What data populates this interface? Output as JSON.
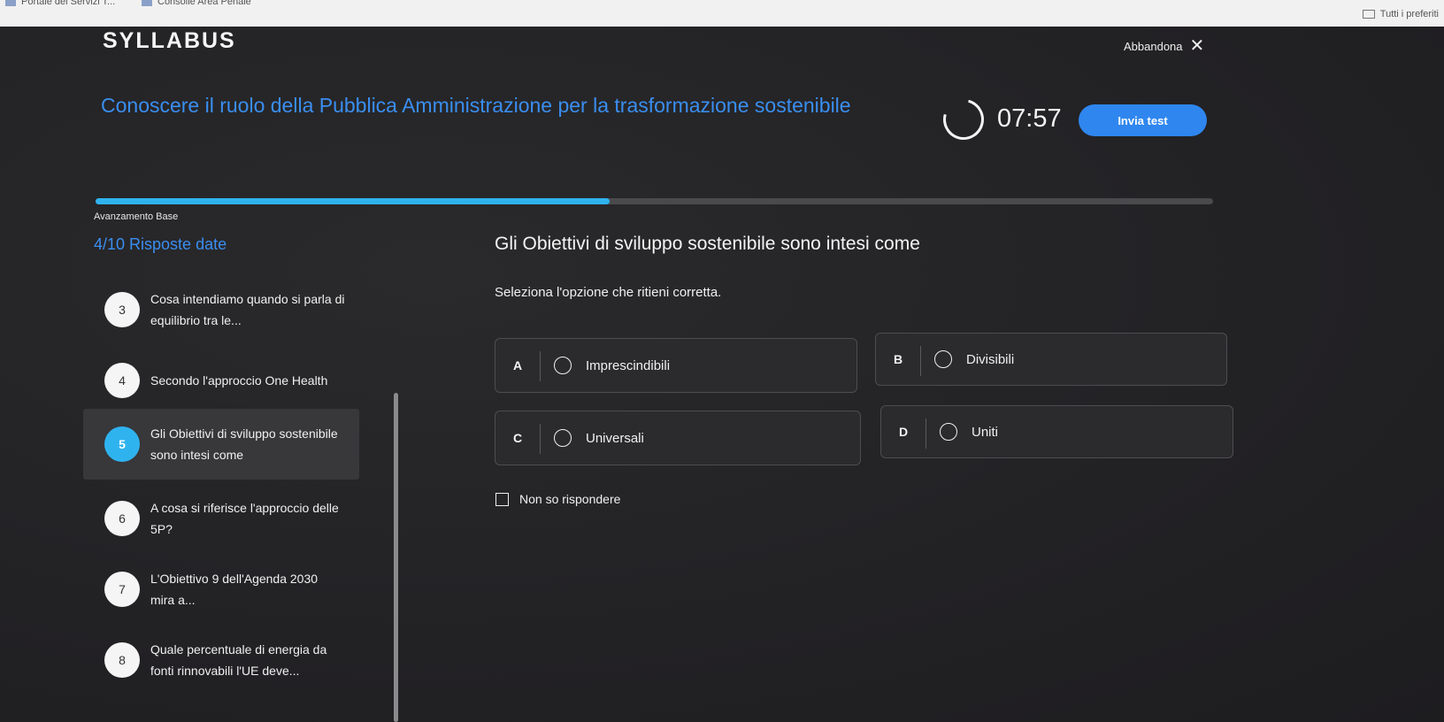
{
  "browser": {
    "bookmarks": [
      "Portale dei Servizi T...",
      "Consolle Area Penale"
    ],
    "all_bookmarks": "Tutti i preferiti"
  },
  "header": {
    "logo": "SYLLABUS",
    "leave_label": "Abbandona"
  },
  "course": {
    "title": "Conoscere il ruolo della Pubblica Amministrazione per la trasformazione sostenibile",
    "timer": "07:57",
    "submit_label": "Invia test"
  },
  "progress": {
    "label": "Avanzamento Base",
    "fraction": 0.46,
    "answered": "4/10 Risposte date"
  },
  "sidebar": {
    "questions": [
      {
        "number": "3",
        "text": "Cosa intendiamo quando si parla di equilibrio tra le..."
      },
      {
        "number": "4",
        "text": "Secondo l'approccio One Health"
      },
      {
        "number": "5",
        "text": "Gli Obiettivi di sviluppo sostenibile sono intesi come"
      },
      {
        "number": "6",
        "text": "A cosa si riferisce l'approccio delle 5P?"
      },
      {
        "number": "7",
        "text": "L'Obiettivo 9 dell'Agenda 2030 mira a..."
      },
      {
        "number": "8",
        "text": "Quale percentuale di energia da fonti rinnovabili l'UE deve..."
      }
    ]
  },
  "question": {
    "title": "Gli Obiettivi di sviluppo sostenibile sono intesi come",
    "instruction": "Seleziona l'opzione che ritieni corretta.",
    "options": [
      {
        "letter": "A",
        "label": "Imprescindibili"
      },
      {
        "letter": "B",
        "label": "Divisibili"
      },
      {
        "letter": "C",
        "label": "Universali"
      },
      {
        "letter": "D",
        "label": "Uniti"
      }
    ],
    "skip_label": "Non so rispondere"
  },
  "colors": {
    "accent": "#2f86ee",
    "progress": "#2fb3ef",
    "background": "#262527"
  }
}
